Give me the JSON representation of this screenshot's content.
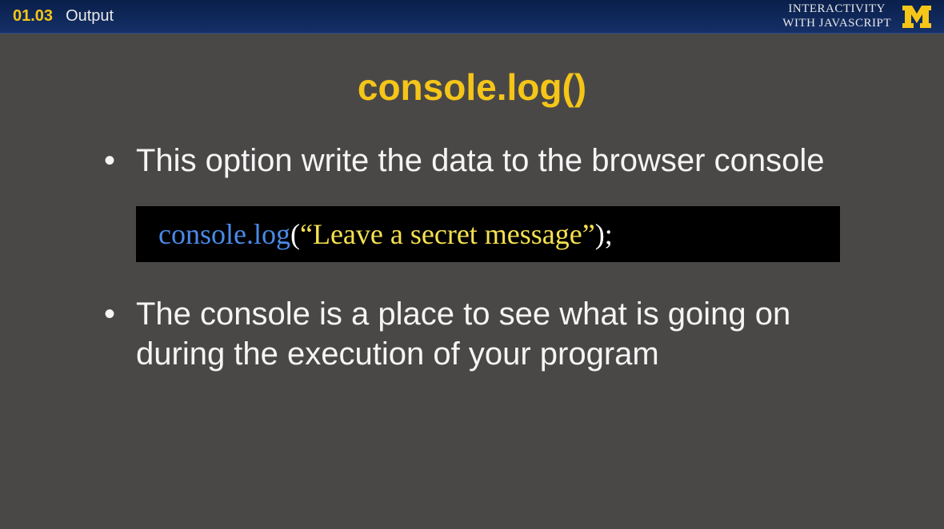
{
  "header": {
    "slide_number": "01.03",
    "title": "Output",
    "course_line1": "INTERACTIVITY",
    "course_line2": "WITH JAVASCRIPT"
  },
  "slide": {
    "heading": "console.log()",
    "bullets": [
      "This option write the data to the browser console",
      "The console is a place to see what is going on during the execution of your program"
    ],
    "code": {
      "part1": "console.log",
      "part2": "(",
      "part3": "“Leave a secret message”",
      "part4": ");"
    }
  }
}
